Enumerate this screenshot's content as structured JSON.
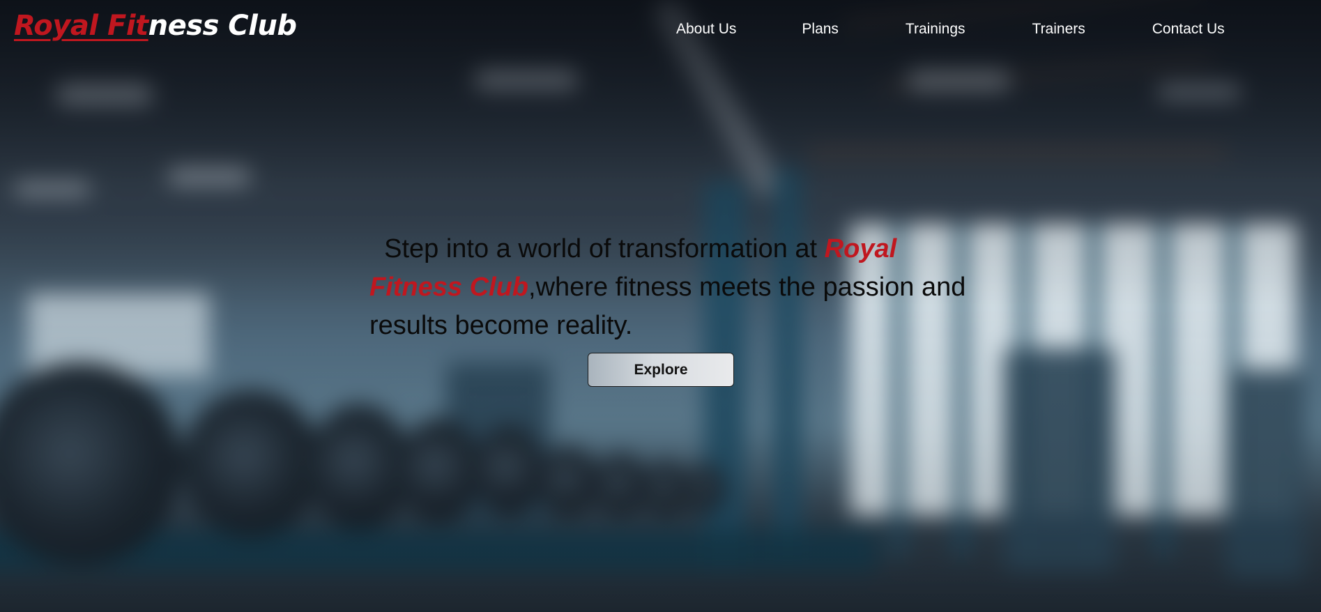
{
  "header": {
    "logo": {
      "part_red": "Royal Fit",
      "part_white": "ness Club"
    },
    "nav": [
      "About Us",
      "Plans",
      "Trainings",
      "Trainers",
      "Contact Us"
    ]
  },
  "hero": {
    "text_before": "Step into a world of transformation at ",
    "brand": "Royal Fitness Club",
    "text_after": ",where fitness meets the passion and results become reality.",
    "button_label": "Explore"
  },
  "colors": {
    "brand_red": "#c0171f",
    "nav_text": "#ffffff",
    "hero_text": "#0a0a0a"
  }
}
